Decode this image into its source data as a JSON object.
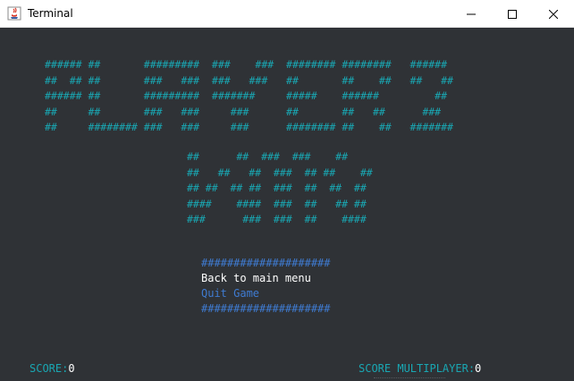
{
  "window": {
    "title": "Terminal",
    "app_icon": "java-cup-icon",
    "controls": {
      "minimize": "minimize-icon",
      "maximize": "maximize-icon",
      "close": "close-icon"
    }
  },
  "terminal": {
    "background": "#2f3236",
    "art_color": "#19a7b3",
    "title_art": "###### ##       #########  ###    ###  ######## ########   ######\n##  ## ##       ###   ###  ###   ###   ##       ##    ##   ##   ##\n###### ##       #########  #######     #####    ######         ##\n##     ##       ###   ###     ###      ##       ##   ##      ###\n##     ######## ###   ###     ###      ######## ##    ##   #######",
    "game_over_art": "##      ##  ###  ###    ##\n##   ##   ##  ###  ## ##    ##\n## ##  ## ##  ###  ##  ##  ##\n####    ####  ###  ##   ## ##\n###      ###  ###  ##    ####",
    "menu": {
      "border_top": "####################",
      "items": [
        {
          "label": "Back to main menu",
          "selected": true,
          "color": "#ffffff"
        },
        {
          "label": "Quit Game",
          "selected": false,
          "color": "#3f7bd1"
        }
      ],
      "border_bottom": "####################",
      "border_color": "#3f7bd1"
    },
    "status": {
      "score_label": "SCORE:",
      "score_value": "0",
      "multiplier_label": "SCORE MULTIPLAYER:",
      "multiplier_value": "0"
    }
  }
}
